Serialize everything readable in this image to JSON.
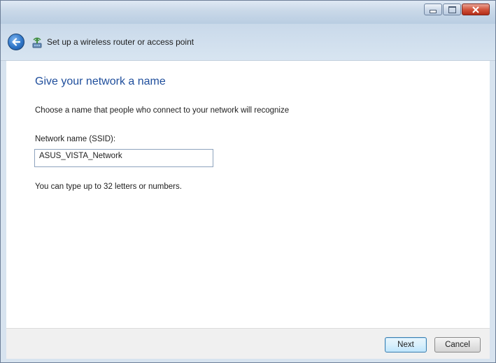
{
  "window": {
    "title": "Set up a wireless router or access point",
    "controls": {
      "minimize": "minimize-icon",
      "maximize": "maximize-icon",
      "close": "close-icon"
    }
  },
  "page": {
    "heading": "Give your network a name",
    "description": "Choose a name that people who connect to your network will recognize",
    "ssid_label": "Network name (SSID):",
    "ssid_value": "ASUS_VISTA_Network",
    "hint": "You can type up to 32 letters or numbers."
  },
  "buttons": {
    "next": "Next",
    "cancel": "Cancel"
  },
  "colors": {
    "heading": "#1f4e9c",
    "close_button": "#c8422a"
  }
}
